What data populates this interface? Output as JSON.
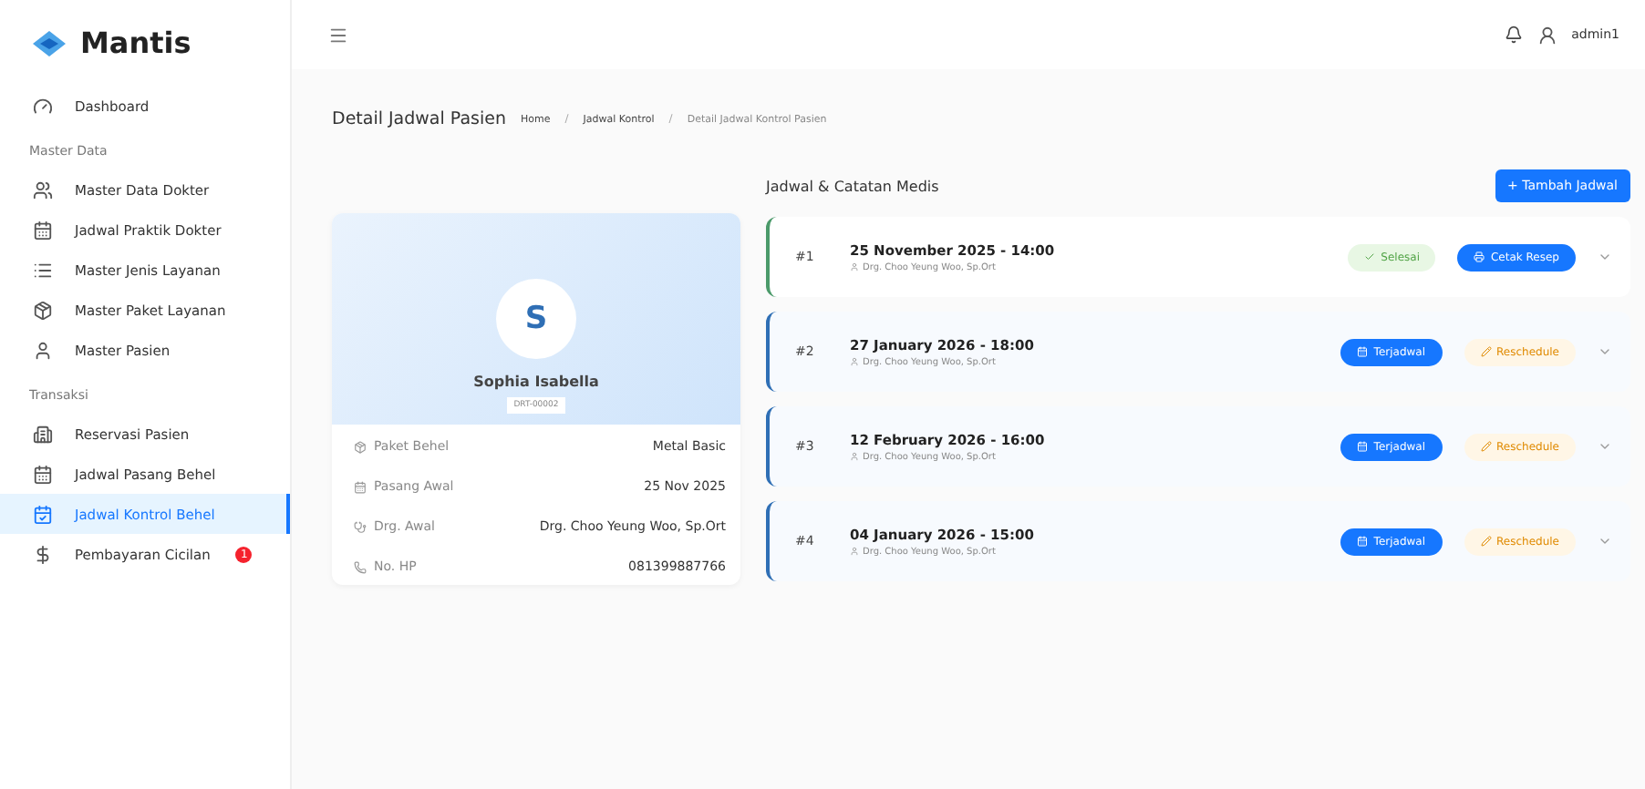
{
  "brand": "Mantis",
  "sidebar": {
    "groups": [
      {
        "items": [
          {
            "label": "Dashboard",
            "selected": false
          }
        ]
      },
      {
        "title": "Master Data",
        "items": [
          {
            "label": "Master Data Dokter",
            "selected": false
          },
          {
            "label": "Jadwal Praktik Dokter",
            "selected": false
          },
          {
            "label": "Master Jenis Layanan",
            "selected": false
          },
          {
            "label": "Master Paket Layanan",
            "selected": false
          },
          {
            "label": "Master Pasien",
            "selected": false
          }
        ]
      },
      {
        "title": "Transaksi",
        "items": [
          {
            "label": "Reservasi Pasien",
            "selected": false
          },
          {
            "label": "Jadwal Pasang Behel",
            "selected": false
          },
          {
            "label": "Jadwal Kontrol Behel",
            "selected": true
          },
          {
            "label": "Pembayaran Cicilan",
            "selected": false,
            "badge": "1"
          }
        ]
      }
    ]
  },
  "header": {
    "user": "admin1"
  },
  "page": {
    "title": "Detail Jadwal Pasien",
    "breadcrumb_separator": "/",
    "breadcrumb": [
      "Home",
      "Jadwal Kontrol",
      "Detail Jadwal Kontrol Pasien"
    ]
  },
  "patient": {
    "initial": "S",
    "name": "Sophia Isabella",
    "code": "DRT-00002",
    "details": [
      {
        "label": "Paket Behel",
        "value": "Metal Basic"
      },
      {
        "label": "Pasang Awal",
        "value": "25 Nov 2025"
      },
      {
        "label": "Drg. Awal",
        "value": "Drg. Choo Yeung Woo, Sp.Ort"
      },
      {
        "label": "No. HP",
        "value": "081399887766"
      }
    ]
  },
  "schedule": {
    "title": "Jadwal & Catatan Medis",
    "add_button": "+ Tambah Jadwal",
    "entries": [
      {
        "number": "#1",
        "datetime": "25 November 2025 - 14:00",
        "doctor": "Drg. Choo Yeung Woo, Sp.Ort",
        "status": {
          "kind": "done",
          "label": "Selesai"
        },
        "action": {
          "kind": "print",
          "label": "Cetak Resep"
        }
      },
      {
        "number": "#2",
        "datetime": "27 January 2026 - 18:00",
        "doctor": "Drg. Choo Yeung Woo, Sp.Ort",
        "status": {
          "kind": "scheduled",
          "label": "Terjadwal"
        },
        "action": {
          "kind": "reschedule",
          "label": "Reschedule"
        }
      },
      {
        "number": "#3",
        "datetime": "12 February 2026 - 16:00",
        "doctor": "Drg. Choo Yeung Woo, Sp.Ort",
        "status": {
          "kind": "scheduled",
          "label": "Terjadwal"
        },
        "action": {
          "kind": "reschedule",
          "label": "Reschedule"
        }
      },
      {
        "number": "#4",
        "datetime": "04 January 2026 - 15:00",
        "doctor": "Drg. Choo Yeung Woo, Sp.Ort",
        "status": {
          "kind": "scheduled",
          "label": "Terjadwal"
        },
        "action": {
          "kind": "reschedule",
          "label": "Reschedule"
        }
      }
    ]
  }
}
